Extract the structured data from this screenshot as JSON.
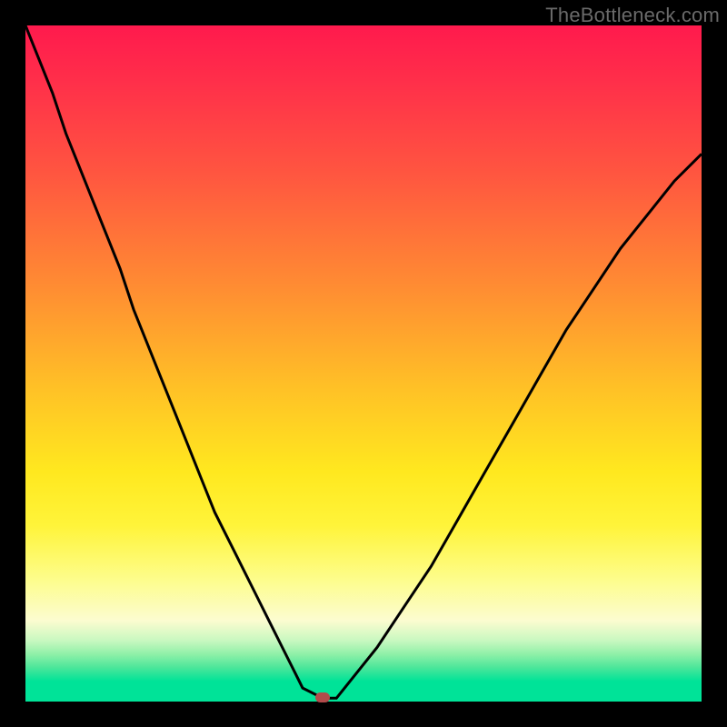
{
  "watermark": "TheBottleneck.com",
  "chart_data": {
    "type": "line",
    "title": "",
    "xlabel": "",
    "ylabel": "",
    "xlim": [
      0,
      100
    ],
    "ylim": [
      0,
      100
    ],
    "series": [
      {
        "name": "curve",
        "x": [
          0,
          2,
          4,
          6,
          8,
          10,
          12,
          14,
          16,
          18,
          20,
          22,
          24,
          26,
          28,
          30,
          32,
          34,
          36,
          38,
          40,
          41,
          43,
          44,
          46,
          48,
          52,
          56,
          60,
          64,
          68,
          72,
          76,
          80,
          84,
          88,
          92,
          96,
          100
        ],
        "values": [
          100,
          95,
          90,
          84,
          79,
          74,
          69,
          64,
          58,
          53,
          48,
          43,
          38,
          33,
          28,
          24,
          20,
          16,
          12,
          8,
          4,
          2,
          1,
          0.5,
          0.5,
          3,
          8,
          14,
          20,
          27,
          34,
          41,
          48,
          55,
          61,
          67,
          72,
          77,
          81
        ]
      }
    ],
    "minimum_marker": {
      "x": 44,
      "y": 0.5
    },
    "gradient_stops": [
      {
        "pos": 0.0,
        "color": "#ff1a4d"
      },
      {
        "pos": 0.38,
        "color": "#ff8a33"
      },
      {
        "pos": 0.66,
        "color": "#ffe81f"
      },
      {
        "pos": 0.88,
        "color": "#fcfcd0"
      },
      {
        "pos": 1.0,
        "color": "#00e398"
      }
    ]
  }
}
